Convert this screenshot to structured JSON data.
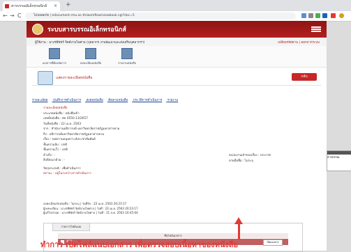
{
  "browser": {
    "tab_title": "สารบรรณอิเล็กทรอนิกส์",
    "new_tab": "+",
    "close": "×",
    "back": "←",
    "forward": "→",
    "reload": "C",
    "url": "ไม่ปลอดภัย | edocument.rmu.ac.th/workflow/viewbook.cgi?doc=5"
  },
  "banner": {
    "title": "ระบบสารบรรณอิเล็กทรอนิกส์"
  },
  "user_bar": {
    "user": "ผู้ใช้งาน : นางรพีพัชร์ จิตต์งามไพศาล (บุคลากร งานพัฒนาและส่งเสริมบุคลากรฯ)",
    "right": "เปลี่ยนรหัสผ่าน | ออกจากระบบ"
  },
  "toolbar": {
    "items": [
      "เอกสารที่ต้องจัดการ",
      "ลงทะเบียนหนังสือ",
      "รายงานหนังสือ"
    ]
  },
  "section": {
    "title": "แสดงรายละเอียดหนังสือ",
    "back_label": "กลับ"
  },
  "tabs": [
    "รายละเอียด",
    "บันทึกการดำเนินการ",
    "ส่งต่อหนังสือ",
    "ติดตามหนังสือ",
    "ประวัติการดำเนินการ",
    "รายงาน"
  ],
  "detail": {
    "heading": "รายละเอียดหนังสือ",
    "lines": [
      "ประเภทหนังสือ : หนังสือเข้า",
      "เลขที่หนังสือ : ศธ 0550.13/2657",
      "วันที่หนังสือ : 22 เม.ย. 2563",
      "จาก : สำนักงานอธิการบดี มหาวิทยาลัยราชภัฏมหาสารคาม",
      "ถึง : อธิการบดีมหาวิทยาลัยราชภัฏมหาสารคาม",
      "เรื่อง : ขอความอนุเคราะห์ประชาสัมพันธ์",
      "ชั้นความลับ : ปกติ",
      "ชั้นความเร็ว : ปกติ",
      "อ้างถึง : -",
      "สิ่งที่ส่งมาด้วย : -"
    ],
    "purpose": "วัตถุประสงค์ : เพื่อดำเนินการ",
    "status": "สถานะ : อยู่ในระหว่างการดำเนินการ",
    "right_lines": [
      "หน่วยงานเจ้าของเรื่อง : ประกาศ",
      "ลายมือชื่อ : ไม่ระบุ"
    ]
  },
  "meta": [
    "ลงทะเบียนรับหนังสือ : ไม่ระบุ | วันที่รับ : 22 เม.ย. 2563 20:23:17",
    "ผู้ลงทะเบียน : นางรพีพัชร์ จิตต์งามไพศาล | วันที่ : 22 เม.ย. 2563 20:23:17",
    "ผู้แก้ไขล่าสุด : นางรพีพัชร์ จิตต์งามไพศาล | วันที่ : 11 ส.ค. 2563 10:45:04"
  ],
  "attachments": {
    "tab": "รายการไฟล์แนบ",
    "header": "ชื่อไฟล์เอกสาร",
    "file_name": "456",
    "open_label": "เปิดเอกสาร"
  },
  "caption": "ทำการ เปิดไฟล์แนบเอกสาร เพื่อตรวจสอบเนื้อหาของหนังสือ",
  "right_panel": {
    "label": "สารบรรณ"
  },
  "colors": {
    "brand": "#b31f1f",
    "caption": "#e53935"
  }
}
